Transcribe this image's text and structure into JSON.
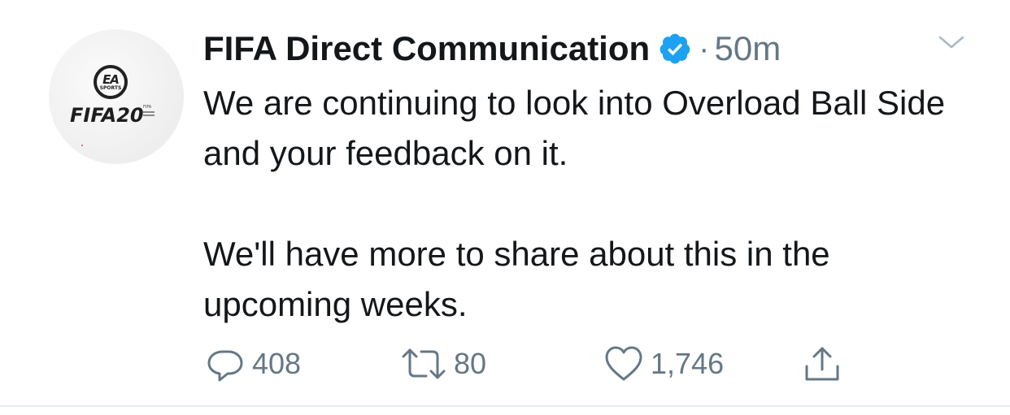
{
  "tweet": {
    "display_name": "FIFA Direct Communication",
    "verified": true,
    "separator": "·",
    "time": "50m",
    "avatar": {
      "ea_letters": "EA",
      "ea_sub": "SPORTS",
      "game_title": "FIFA20",
      "tag": "FIFA"
    },
    "paragraphs": [
      "We are continuing to look into Overload Ball Side and your feedback on it.",
      "We'll have more to share about this in the upcoming weeks."
    ],
    "actions": {
      "replies": "408",
      "retweets": "80",
      "likes": "1,746"
    }
  },
  "colors": {
    "text": "#14171a",
    "secondary": "#657786",
    "verified_blue": "#1da1f2",
    "divider": "#e6ecf0"
  },
  "icons": {
    "verified": "verified-badge-icon",
    "caret": "chevron-down-icon",
    "reply": "reply-icon",
    "retweet": "retweet-icon",
    "like": "heart-icon",
    "share": "share-icon"
  }
}
